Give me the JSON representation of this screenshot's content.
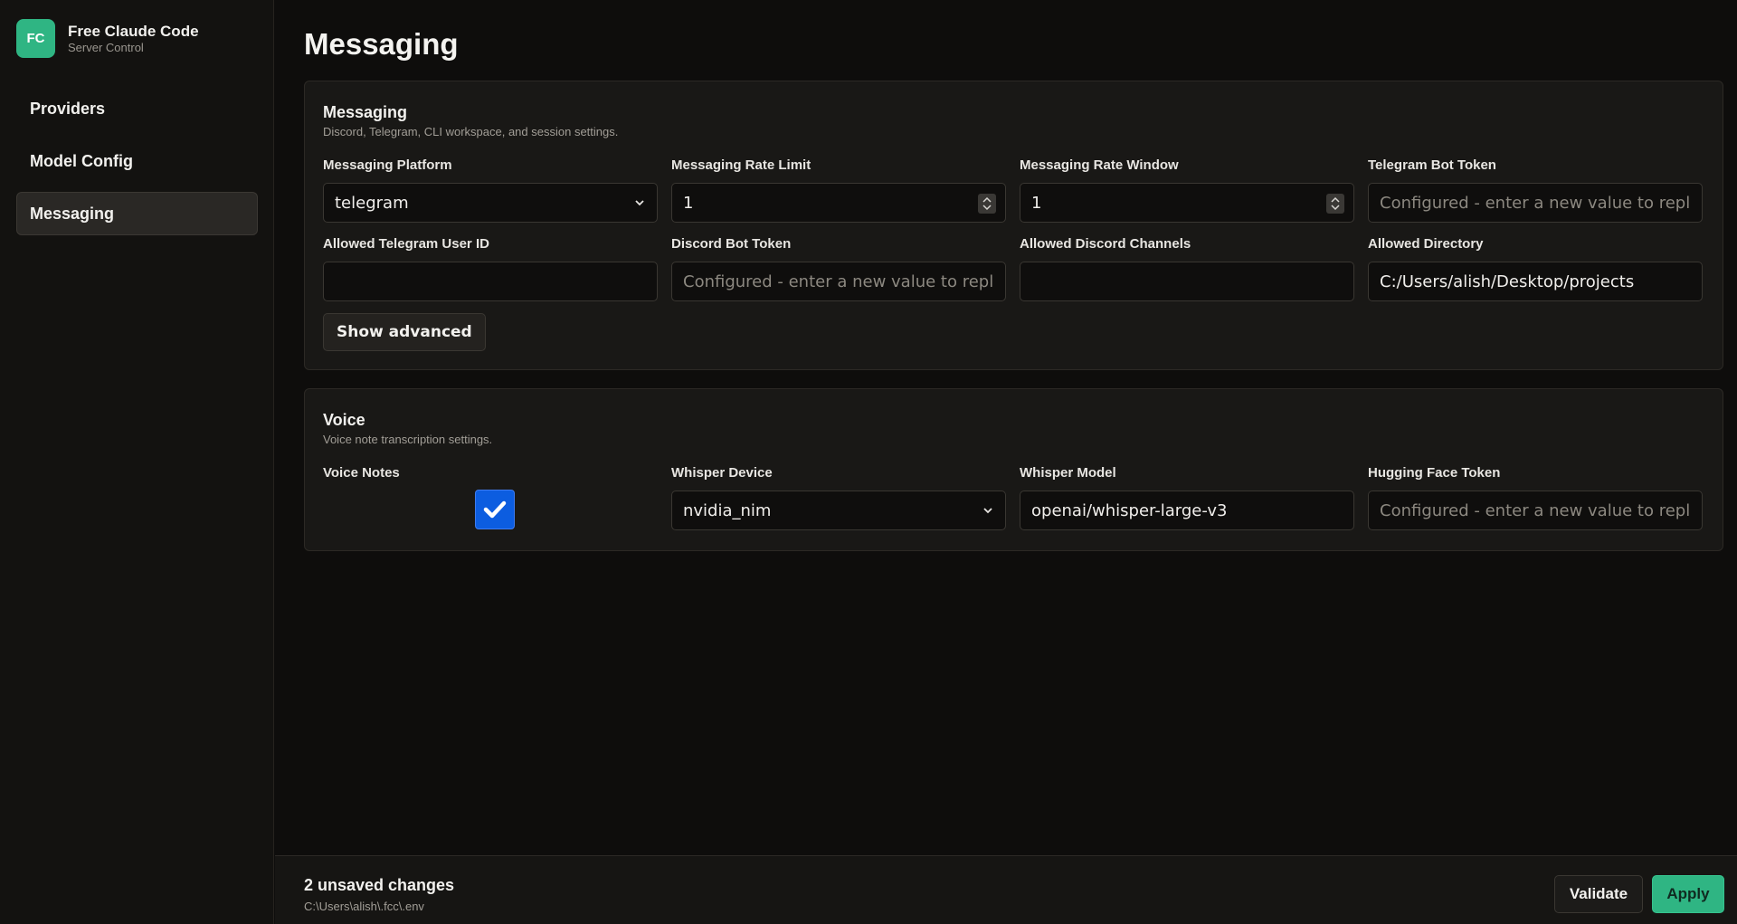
{
  "brand": {
    "logo": "FC",
    "title": "Free Claude Code",
    "subtitle": "Server Control"
  },
  "sidebar": {
    "items": [
      {
        "label": "Providers",
        "active": false
      },
      {
        "label": "Model Config",
        "active": false
      },
      {
        "label": "Messaging",
        "active": true
      }
    ]
  },
  "page": {
    "title": "Messaging"
  },
  "messaging": {
    "title": "Messaging",
    "description": "Discord, Telegram, CLI workspace, and session settings.",
    "fields": {
      "platform": {
        "label": "Messaging Platform",
        "value": "telegram"
      },
      "rate_limit": {
        "label": "Messaging Rate Limit",
        "value": "1"
      },
      "rate_window": {
        "label": "Messaging Rate Window",
        "value": "1"
      },
      "telegram_token": {
        "label": "Telegram Bot Token",
        "placeholder": "Configured - enter a new value to replace"
      },
      "telegram_user": {
        "label": "Allowed Telegram User ID",
        "value": ""
      },
      "discord_token": {
        "label": "Discord Bot Token",
        "placeholder": "Configured - enter a new value to replace"
      },
      "discord_channels": {
        "label": "Allowed Discord Channels",
        "value": ""
      },
      "allowed_dir": {
        "label": "Allowed Directory",
        "value": "C:/Users/alish/Desktop/projects"
      }
    },
    "advanced_label": "Show advanced"
  },
  "voice": {
    "title": "Voice",
    "description": "Voice note transcription settings.",
    "fields": {
      "voice_notes": {
        "label": "Voice Notes",
        "checked": true
      },
      "whisper_device": {
        "label": "Whisper Device",
        "value": "nvidia_nim"
      },
      "whisper_model": {
        "label": "Whisper Model",
        "value": "openai/whisper-large-v3"
      },
      "hf_token": {
        "label": "Hugging Face Token",
        "placeholder": "Configured - enter a new value to replace"
      }
    }
  },
  "footer": {
    "changes": "2 unsaved changes",
    "path": "C:\\Users\\alish\\.fcc\\.env",
    "validate_label": "Validate",
    "apply_label": "Apply"
  },
  "colors": {
    "accent": "#2fb583",
    "checkbox": "#0c5de0",
    "background": "#0e0d0c"
  },
  "icons": {
    "select_arrow": "chevron-down-icon",
    "number_spinner": "spinner-icon",
    "check": "check-icon"
  }
}
